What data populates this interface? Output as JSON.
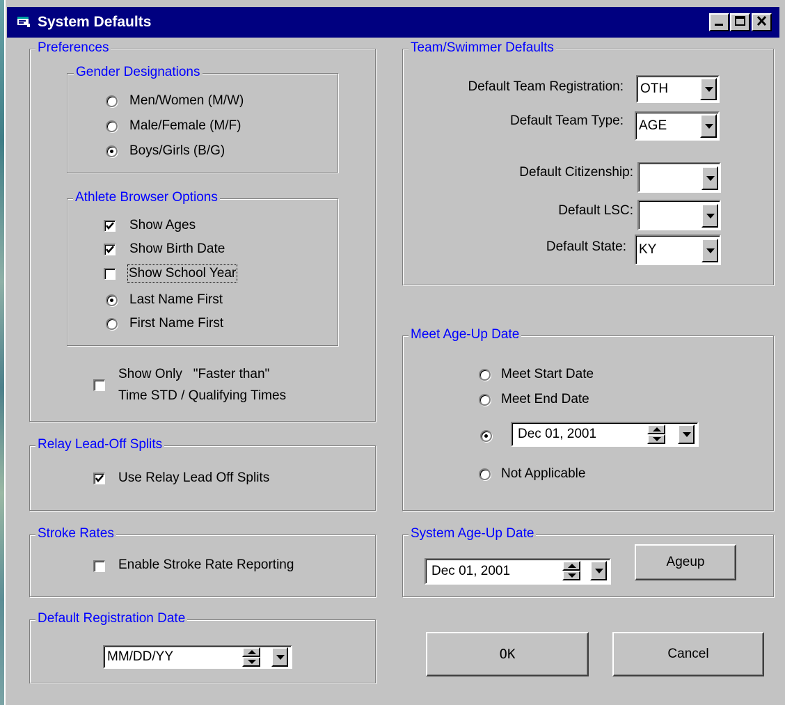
{
  "window": {
    "title": "System Defaults",
    "controls": [
      "minimize-icon",
      "maximize-icon",
      "close-icon"
    ]
  },
  "preferences": {
    "legend": "Preferences",
    "gender": {
      "legend": "Gender Designations",
      "options": [
        "Men/Women (M/W)",
        "Male/Female (M/F)",
        "Boys/Girls (B/G)"
      ],
      "selected": "Boys/Girls (B/G)"
    },
    "athlete_browser": {
      "legend": "Athlete Browser Options",
      "show_ages": {
        "label": "Show Ages",
        "checked": true
      },
      "show_birth_date": {
        "label": "Show Birth Date",
        "checked": true
      },
      "show_school_year": {
        "label": "Show School Year",
        "checked": false
      },
      "name_order": {
        "options": [
          "Last Name First",
          "First Name First"
        ],
        "selected": "Last Name First"
      }
    },
    "faster_than": {
      "line1": "Show Only   \"Faster than\"",
      "line2": "Time STD / Qualifying Times",
      "checked": false
    }
  },
  "relay": {
    "legend": "Relay Lead-Off Splits",
    "option": {
      "label": "Use Relay Lead Off Splits",
      "checked": true
    }
  },
  "stroke_rates": {
    "legend": "Stroke Rates",
    "option": {
      "label": "Enable Stroke Rate Reporting",
      "checked": false
    }
  },
  "default_registration_date": {
    "legend": "Default Registration Date",
    "value": "MM/DD/YY"
  },
  "team_swimmer": {
    "legend": "Team/Swimmer Defaults",
    "team_registration": {
      "label": "Default Team Registration:",
      "value": "OTH"
    },
    "team_type": {
      "label": "Default Team Type:",
      "value": "AGE"
    },
    "citizenship": {
      "label": "Default Citizenship:",
      "value": ""
    },
    "lsc": {
      "label": "Default LSC:",
      "value": ""
    },
    "state": {
      "label": "Default State:",
      "value": "KY"
    }
  },
  "meet_ageup": {
    "legend": "Meet Age-Up Date",
    "start_label": "Meet Start Date",
    "end_label": "Meet End Date",
    "date_value": "Dec 01, 2001",
    "na_label": "Not Applicable",
    "selected": "date"
  },
  "system_ageup": {
    "legend": "System Age-Up Date",
    "date_value": "Dec 01, 2001",
    "ageup_button": "Ageup"
  },
  "buttons": {
    "ok": "OK",
    "cancel": "Cancel"
  },
  "colors": {
    "title_bar": "#000080",
    "group_legend": "#0000ff",
    "face": "#c3c3c3"
  }
}
